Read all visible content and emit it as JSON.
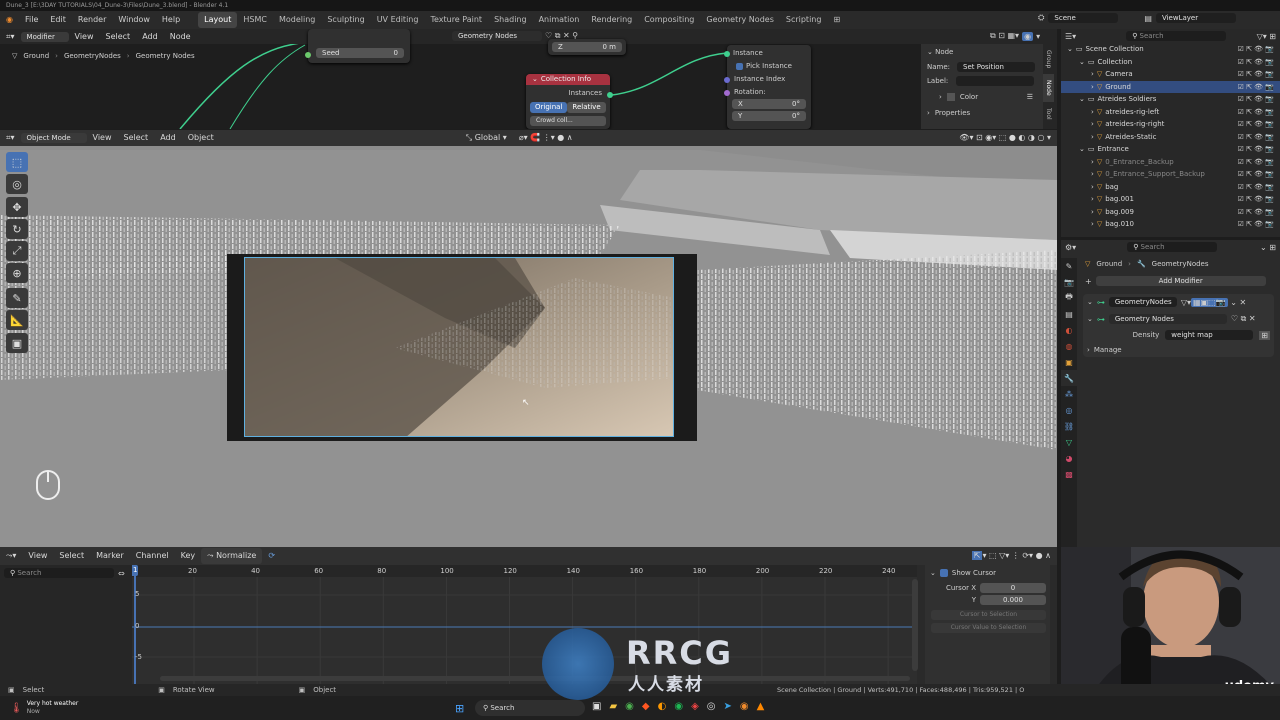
{
  "window_title": "Dune_3 [E:\\3DAY TUTORIALS\\04_Dune-3\\Files\\Dune_3.blend] - Blender 4.1",
  "menu": [
    "File",
    "Edit",
    "Render",
    "Window",
    "Help"
  ],
  "workspaces": [
    "Layout",
    "HSMC",
    "Modeling",
    "Sculpting",
    "UV Editing",
    "Texture Paint",
    "Shading",
    "Animation",
    "Rendering",
    "Compositing",
    "Geometry Nodes",
    "Scripting"
  ],
  "scene": {
    "label": "Scene",
    "view_layer": "ViewLayer"
  },
  "node_editor": {
    "editor_mode": "Modifier",
    "menus": [
      "View",
      "Select",
      "Add",
      "Node"
    ],
    "tree_name": "Geometry Nodes",
    "breadcrumb": [
      "Ground",
      "GeometryNodes",
      "Geometry Nodes"
    ],
    "seed_label": "Seed",
    "seed_value": "0",
    "z_label": "Z",
    "z_value": "0 m",
    "collection_info": {
      "title": "Collection Info",
      "output": "Instances",
      "original": "Original",
      "relative": "Relative",
      "collection": "Crowd coll..."
    },
    "instance_node": {
      "instance": "Instance",
      "pick_instance": "Pick Instance",
      "instance_index": "Instance Index",
      "rotation": "Rotation:",
      "x_label": "X",
      "x_value": "0°",
      "y_label": "Y",
      "y_value": "0°"
    }
  },
  "node_panel": {
    "title": "Node",
    "name_label": "Name:",
    "name_value": "Set Position",
    "label_label": "Label:",
    "label_value": "",
    "color": "Color",
    "properties": "Properties",
    "side_tabs": [
      "Group",
      "Node",
      "Tool"
    ]
  },
  "viewport": {
    "mode": "Object Mode",
    "menus": [
      "View",
      "Select",
      "Add",
      "Object"
    ],
    "transform": "Global"
  },
  "outliner": {
    "search_placeholder": "Search",
    "items": [
      {
        "name": "Scene Collection",
        "indent": 0,
        "sel": false
      },
      {
        "name": "Collection",
        "indent": 1,
        "sel": false
      },
      {
        "name": "Camera",
        "indent": 2,
        "sel": false
      },
      {
        "name": "Ground",
        "indent": 2,
        "sel": true
      },
      {
        "name": "Atreides Soldiers",
        "indent": 1,
        "sel": false
      },
      {
        "name": "atreides-rig-left",
        "indent": 2,
        "sel": false
      },
      {
        "name": "atreides-rig-right",
        "indent": 2,
        "sel": false
      },
      {
        "name": "Atreides-Static",
        "indent": 2,
        "sel": false
      },
      {
        "name": "Entrance",
        "indent": 1,
        "sel": false
      },
      {
        "name": "0_Entrance_Backup",
        "indent": 2,
        "sel": false,
        "dim": true
      },
      {
        "name": "0_Entrance_Support_Backup",
        "indent": 2,
        "sel": false,
        "dim": true
      },
      {
        "name": "bag",
        "indent": 2,
        "sel": false
      },
      {
        "name": "bag.001",
        "indent": 2,
        "sel": false
      },
      {
        "name": "bag.009",
        "indent": 2,
        "sel": false
      },
      {
        "name": "bag.010",
        "indent": 2,
        "sel": false
      }
    ]
  },
  "properties": {
    "search_placeholder": "Search",
    "breadcrumb": [
      "Ground",
      "GeometryNodes"
    ],
    "add_modifier": "Add Modifier",
    "modifier_name": "GeometryNodes",
    "node_group": "Geometry Nodes",
    "density_label": "Density",
    "density_value": "weight map",
    "manage": "Manage"
  },
  "graph_editor": {
    "menus": [
      "View",
      "Select",
      "Marker",
      "Channel",
      "Key"
    ],
    "normalize": "Normalize",
    "search_placeholder": "Search",
    "frame_ticks": [
      "20",
      "40",
      "60",
      "80",
      "100",
      "120",
      "140",
      "160",
      "180",
      "200",
      "220",
      "240"
    ],
    "y_ticks": [
      "5",
      "0",
      "-5"
    ],
    "current_frame": "1",
    "show_cursor": "Show Cursor",
    "cursor_x_label": "Cursor X",
    "cursor_x_value": "0",
    "cursor_y_label": "Y",
    "cursor_y_value": "0.000",
    "cursor_to_selection": "Cursor to Selection",
    "cursor_value_to_selection": "Cursor Value to Selection"
  },
  "statusbar": {
    "select": "Select",
    "rotate": "Rotate View",
    "object": "Object",
    "stats": "Scene Collection | Ground | Verts:491,710 | Faces:488,496 | Tris:959,521 | O"
  },
  "taskbar": {
    "weather_title": "Very hot weather",
    "weather_sub": "Now",
    "search": "Search"
  },
  "watermark": {
    "brand": "RRCG",
    "sub": "人人素材"
  },
  "udemy": "udemy",
  "colors": {
    "accent": "#4772b3",
    "selection": "#334d80",
    "node_red": "#a83240",
    "link_green": "#3fcf8e"
  }
}
